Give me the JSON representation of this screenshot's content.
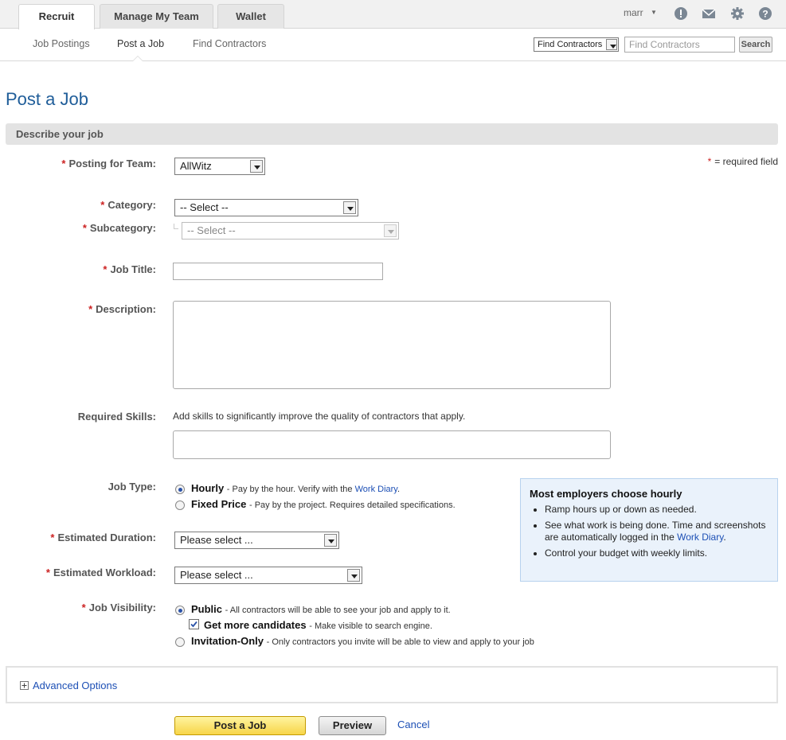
{
  "tabs": [
    {
      "label": "Recruit",
      "active": true
    },
    {
      "label": "Manage My Team",
      "active": false
    },
    {
      "label": "Wallet",
      "active": false
    }
  ],
  "user": {
    "name": "marr"
  },
  "subnav": [
    "Job Postings",
    "Post a Job",
    "Find Contractors"
  ],
  "search": {
    "scope": "Find Contractors",
    "placeholder": "Find Contractors",
    "button": "Search"
  },
  "page": {
    "title": "Post a Job",
    "section": "Describe your job",
    "required_note": "= required field",
    "required_star": "*"
  },
  "form": {
    "team": {
      "label": "Posting for Team:",
      "value": "AllWitz"
    },
    "category": {
      "label": "Category:",
      "value": "-- Select --"
    },
    "subcategory": {
      "label": "Subcategory:",
      "value": "-- Select --"
    },
    "job_title": {
      "label": "Job Title:",
      "value": ""
    },
    "description": {
      "label": "Description:",
      "value": ""
    },
    "skills": {
      "label": "Required Skills:",
      "hint": "Add skills to significantly improve the quality of contractors that apply."
    },
    "job_type": {
      "label": "Job Type:",
      "hourly": {
        "title": "Hourly",
        "desc": "- Pay by the hour. Verify with the ",
        "link": "Work Diary",
        "tail": "."
      },
      "fixed": {
        "title": "Fixed Price",
        "desc": "- Pay by the project. Requires detailed specifications."
      },
      "selected": "Hourly"
    },
    "duration": {
      "label": "Estimated Duration:",
      "value": "Please select ..."
    },
    "workload": {
      "label": "Estimated Workload:",
      "value": "Please select ..."
    },
    "visibility": {
      "label": "Job Visibility:",
      "public": {
        "title": "Public",
        "desc": "- All contractors will be able to see your job and apply to it."
      },
      "more": {
        "title": "Get more candidates",
        "desc": "- Make visible to search engine.",
        "checked": true
      },
      "invite": {
        "title": "Invitation-Only",
        "desc": "- Only contractors you invite will be able to view and apply to your job"
      },
      "selected": "Public"
    }
  },
  "tip": {
    "title": "Most employers choose hourly",
    "item1": "Ramp hours up or down as needed.",
    "item2_pre": "See what work is being done. Time and screenshots are automatically logged in the ",
    "item2_link": "Work Diary",
    "item2_post": ".",
    "item3": "Control your budget with weekly limits."
  },
  "advanced": {
    "label": "Advanced Options"
  },
  "actions": {
    "post": "Post a Job",
    "preview": "Preview",
    "cancel": "Cancel"
  },
  "colors": {
    "accent": "#1f5d99",
    "link": "#1c4fb5",
    "required": "#cc2222",
    "post_button": "#f7d548",
    "tip_bg": "#eaf2fb"
  },
  "icons": [
    "alert-icon",
    "mail-icon",
    "gear-icon",
    "help-icon",
    "chevron-down-icon",
    "plus-icon"
  ]
}
